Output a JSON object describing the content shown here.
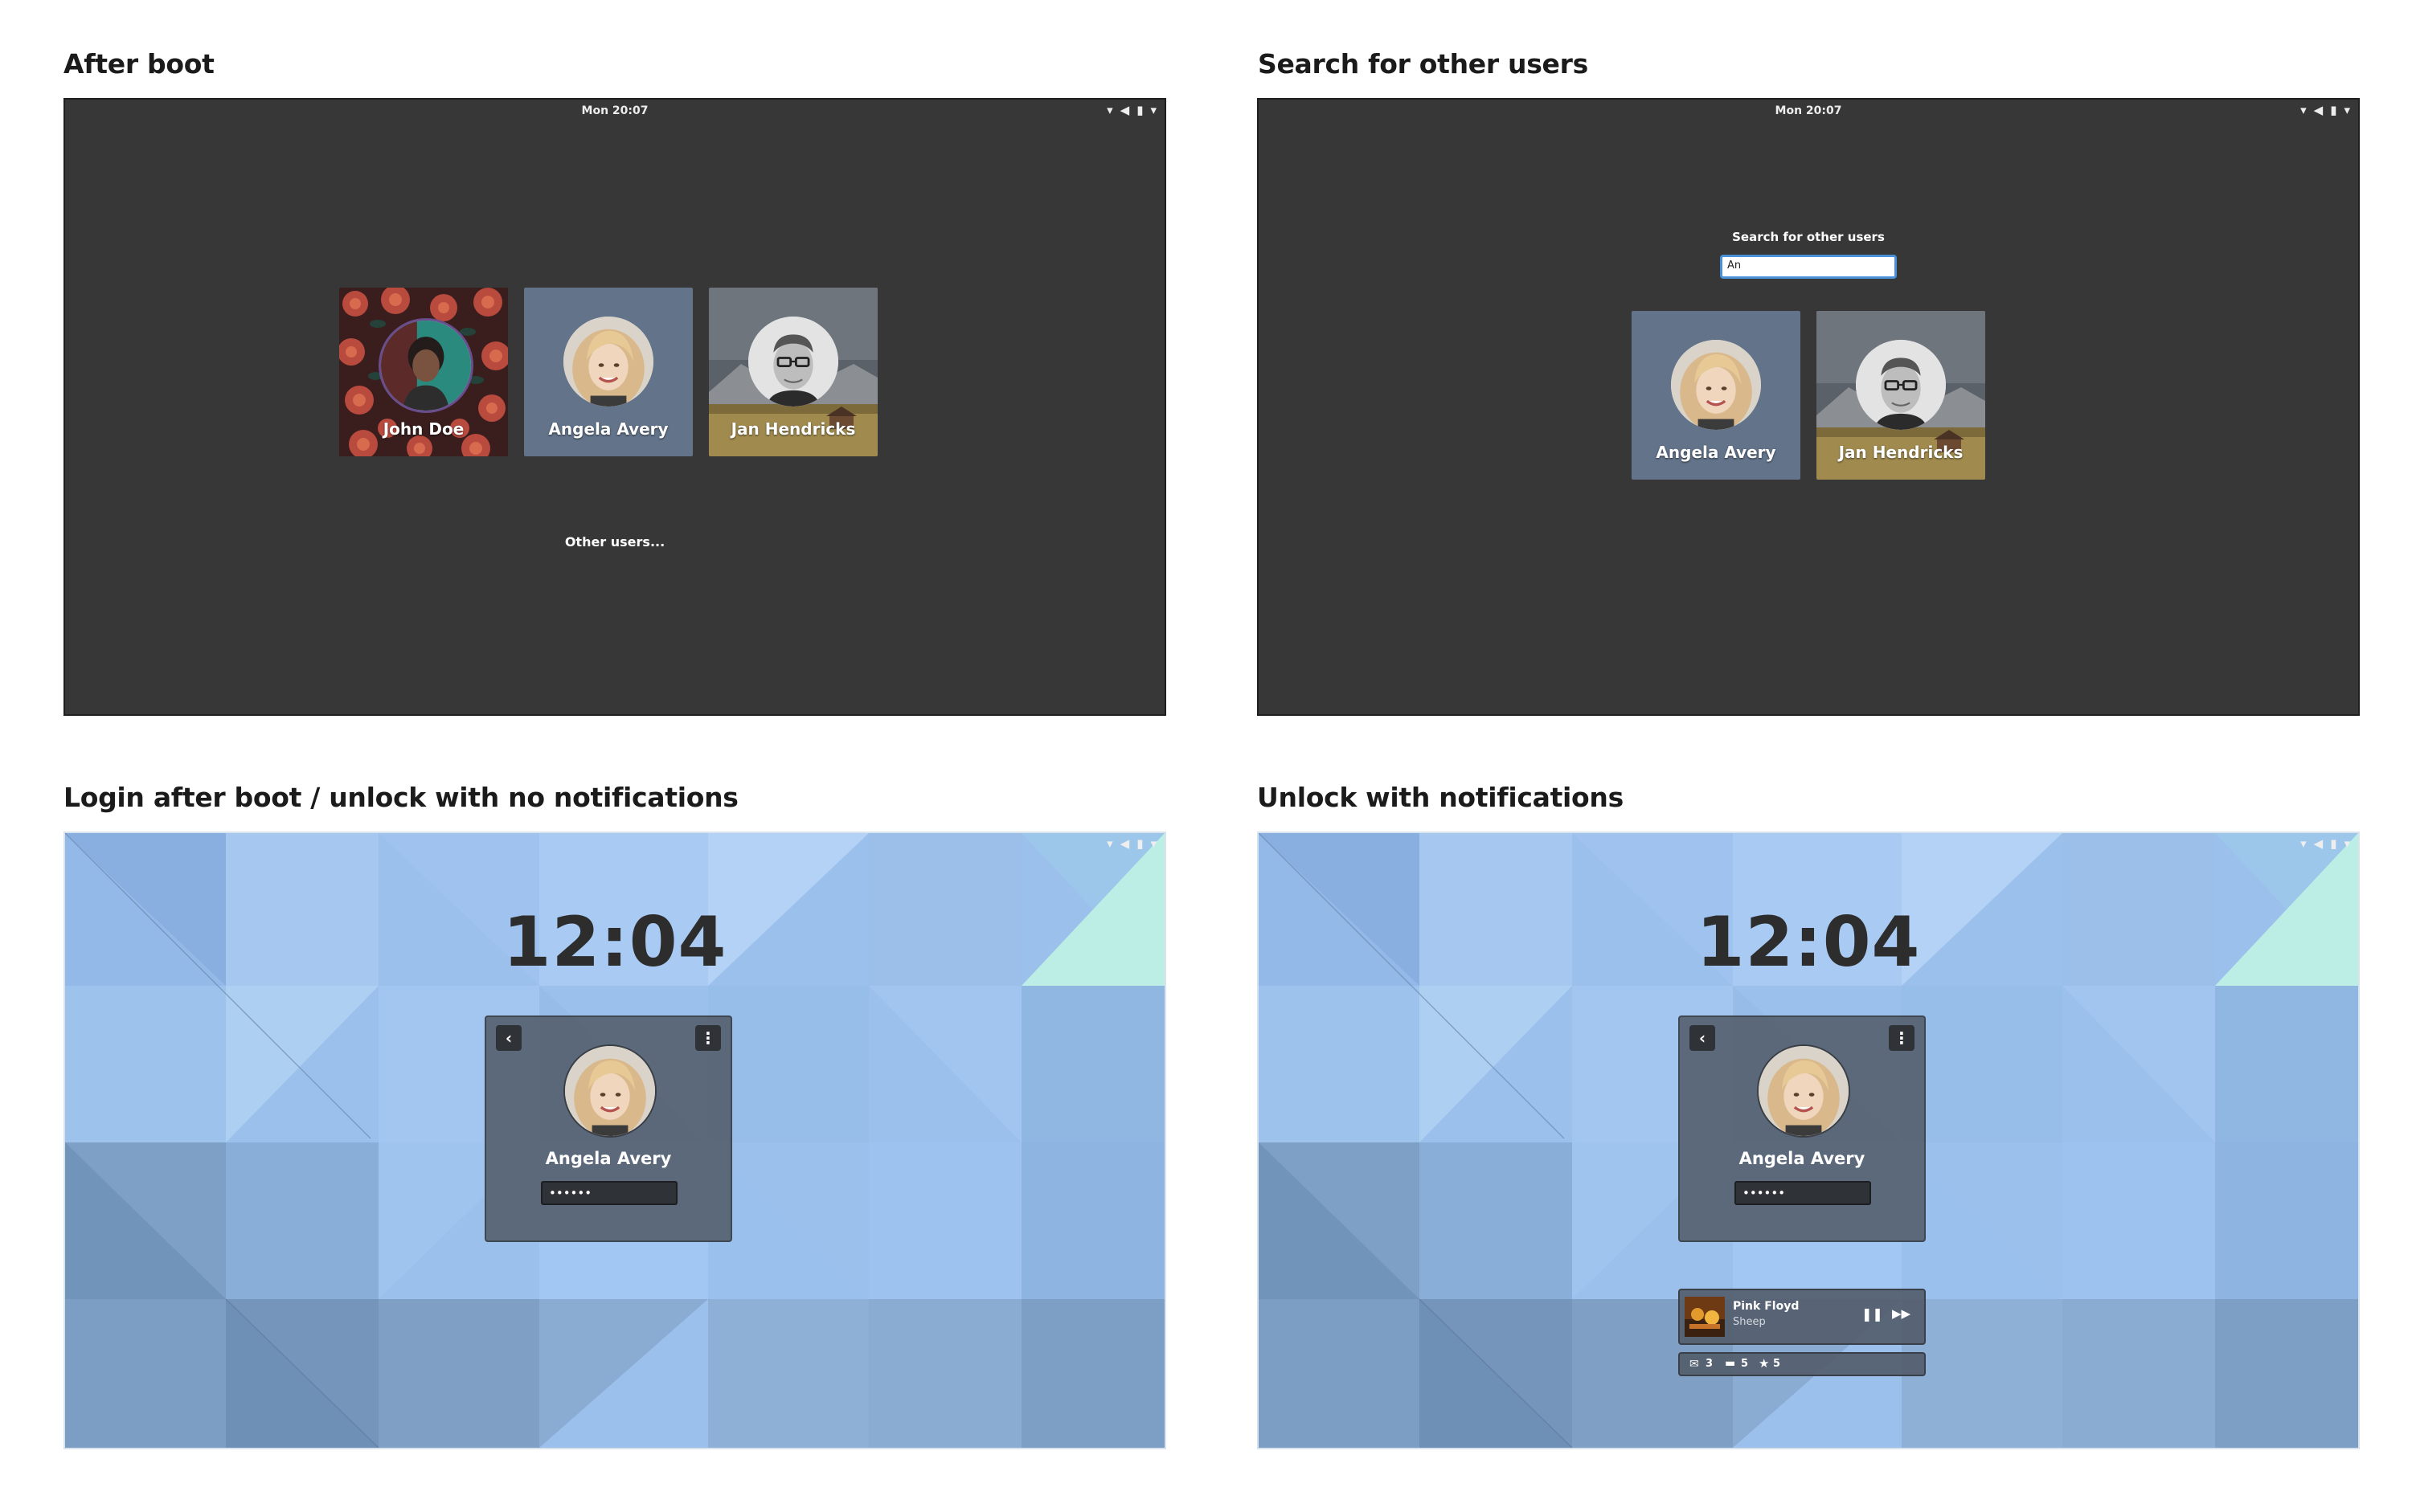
{
  "panels": [
    {
      "title": "After boot"
    },
    {
      "title": "Search for other users"
    },
    {
      "title": "Login after boot / unlock with no notifications"
    },
    {
      "title": "Unlock with notifications"
    }
  ],
  "topbar": {
    "clock": "Mon 20:07",
    "icons": [
      "wifi-icon",
      "volume-icon",
      "battery-icon",
      "chevron-down-icon"
    ]
  },
  "after_boot": {
    "users": [
      {
        "name": "John Doe",
        "background": "red-floral"
      },
      {
        "name": "Angela Avery",
        "background": "slate-blue"
      },
      {
        "name": "Jan Hendricks",
        "background": "mountain-landscape"
      }
    ],
    "other_users_label": "Other users..."
  },
  "search": {
    "label": "Search for other users",
    "query": "An",
    "results": [
      {
        "name": "Angela Avery"
      },
      {
        "name": "Jan Hendricks"
      }
    ]
  },
  "lock_login": {
    "time": "12:04",
    "user_name": "Angela Avery",
    "password_mask": "••••••",
    "back_icon": "chevron-left-icon",
    "menu_icon": "vertical-dots-icon"
  },
  "lock_notifications": {
    "time": "12:04",
    "user_name": "Angela Avery",
    "password_mask": "••••••",
    "media": {
      "artist": "Pink Floyd",
      "track": "Sheep",
      "controls": [
        "pause-icon",
        "skip-forward-icon"
      ]
    },
    "counts": {
      "mail": "3",
      "chat": "5",
      "star": "5"
    }
  },
  "colors": {
    "dark_bg": "#373737",
    "lock_bg": "#8fb6e6",
    "accent": "#4a90d9",
    "card": "#525c6a"
  }
}
